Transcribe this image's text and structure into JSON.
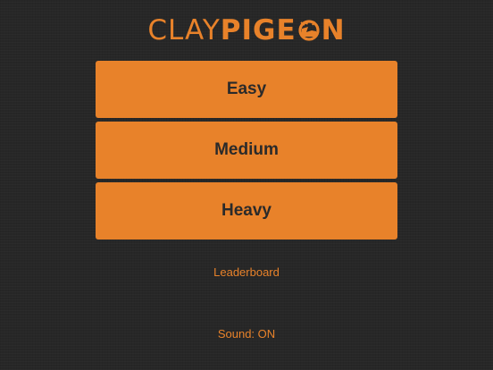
{
  "logo": {
    "light_text": "CLAY",
    "bold_text_1": "PIGE",
    "icon": "clay-pigeon-o-icon",
    "bold_text_2": "N",
    "color": "#e8822a"
  },
  "menu": {
    "easy_label": "Easy",
    "medium_label": "Medium",
    "heavy_label": "Heavy"
  },
  "links": {
    "leaderboard_label": "Leaderboard",
    "sound_label": "Sound: ON"
  },
  "colors": {
    "background": "#272727",
    "accent": "#e8822a",
    "button_text": "#2a2a2a"
  }
}
